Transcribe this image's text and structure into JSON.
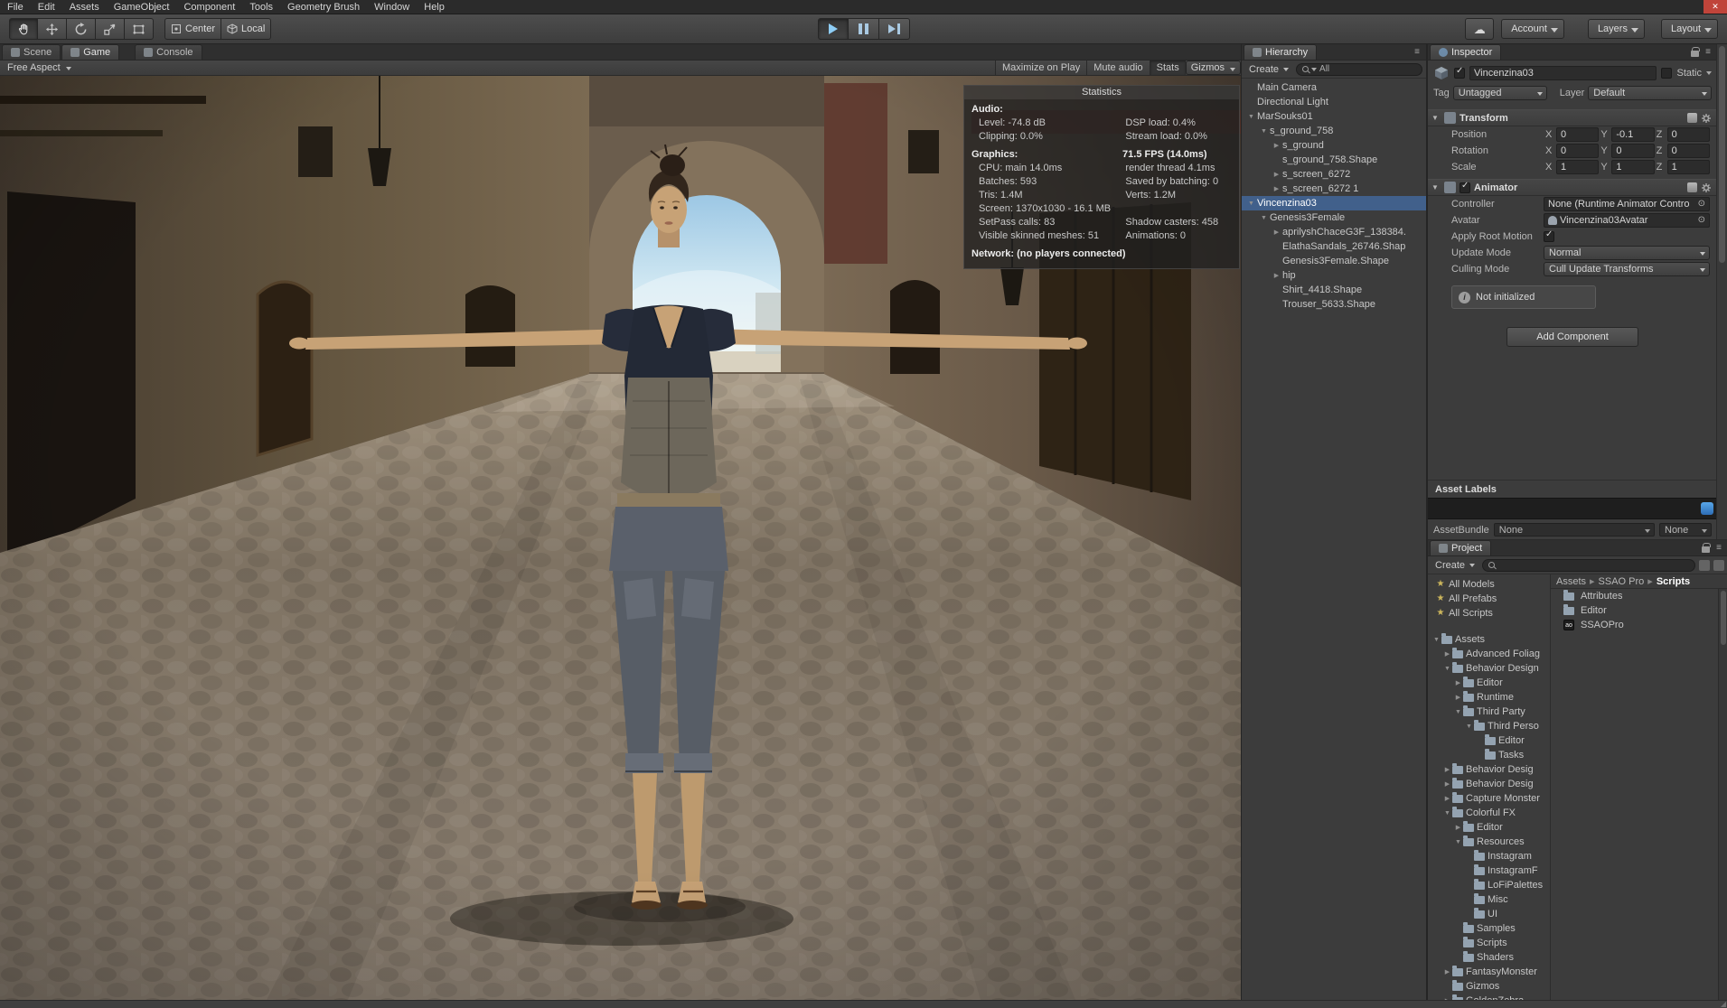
{
  "icons": {
    "close": "✕",
    "cloud": "☁",
    "star": "★",
    "info": "i",
    "picker": "⊙",
    "menu": "≡",
    "grip": "◢"
  },
  "menu": {
    "items": [
      "File",
      "Edit",
      "Assets",
      "GameObject",
      "Component",
      "Tools",
      "Geometry Brush",
      "Window",
      "Help"
    ]
  },
  "toolbar": {
    "center": "Center",
    "local": "Local",
    "account": "Account",
    "layers": "Layers",
    "layout": "Layout"
  },
  "left_tabs": [
    {
      "label": "Scene"
    },
    {
      "label": "Game",
      "active": true
    },
    {
      "label": "Console",
      "offset": true
    }
  ],
  "game_bar": {
    "aspect": "Free Aspect",
    "buttons": [
      {
        "label": "Maximize on Play"
      },
      {
        "label": "Mute audio"
      },
      {
        "label": "Stats",
        "active": true
      },
      {
        "label": "Gizmos",
        "dropdown": true
      }
    ]
  },
  "statistics": {
    "title": "Statistics",
    "rows": [
      {
        "left": "Audio:",
        "right": "",
        "bold": true
      },
      {
        "left": "Level: -74.8 dB",
        "right": "DSP load: 0.4%",
        "indent": true
      },
      {
        "left": "Clipping: 0.0%",
        "right": "Stream load: 0.0%",
        "indent": true
      },
      {
        "left": "Graphics:",
        "right": "71.5 FPS (14.0ms)",
        "bold": true,
        "gap": true
      },
      {
        "left": "CPU: main 14.0ms",
        "right": "render thread 4.1ms",
        "indent": true
      },
      {
        "left": "Batches: 593",
        "right": "Saved by batching: 0",
        "indent": true
      },
      {
        "left": "Tris: 1.4M",
        "right": "Verts: 1.2M",
        "indent": true
      },
      {
        "left": "Screen: 1370x1030 - 16.1 MB",
        "right": "",
        "indent": true
      },
      {
        "left": "SetPass calls: 83",
        "right": "Shadow casters: 458",
        "indent": true
      },
      {
        "left": "Visible skinned meshes: 51",
        "right": "Animations: 0",
        "indent": true
      },
      {
        "left": "Network: (no players connected)",
        "right": "",
        "bold": true,
        "gap": true
      }
    ]
  },
  "hierarchy": {
    "tab": "Hierarchy",
    "create": "Create",
    "search_text": "All",
    "items": [
      {
        "label": "Main Camera",
        "depth": 0
      },
      {
        "label": "Directional Light",
        "depth": 0
      },
      {
        "label": "MarSouks01",
        "depth": 0,
        "arrow": "down"
      },
      {
        "label": "s_ground_758",
        "depth": 1,
        "arrow": "down"
      },
      {
        "label": "s_ground",
        "depth": 2,
        "arrow": "right"
      },
      {
        "label": "s_ground_758.Shape",
        "depth": 2
      },
      {
        "label": "s_screen_6272",
        "depth": 2,
        "arrow": "right"
      },
      {
        "label": "s_screen_6272 1",
        "depth": 2,
        "arrow": "right"
      },
      {
        "label": "Vincenzina03",
        "depth": 0,
        "arrow": "down",
        "selected": true
      },
      {
        "label": "Genesis3Female",
        "depth": 1,
        "arrow": "down"
      },
      {
        "label": "aprilyshChaceG3F_138384.",
        "depth": 2,
        "arrow": "right"
      },
      {
        "label": "ElathaSandals_26746.Shap",
        "depth": 2
      },
      {
        "label": "Genesis3Female.Shape",
        "depth": 2
      },
      {
        "label": "hip",
        "depth": 2,
        "arrow": "right"
      },
      {
        "label": "Shirt_4418.Shape",
        "depth": 2
      },
      {
        "label": "Trouser_5633.Shape",
        "depth": 2
      }
    ]
  },
  "inspector": {
    "tab": "Inspector",
    "name": "Vincenzina03",
    "static_label": "Static",
    "tag_label": "Tag",
    "tag_value": "Untagged",
    "layer_label": "Layer",
    "layer_value": "Default",
    "transform": {
      "title": "Transform",
      "axis": [
        "X",
        "Y",
        "Z"
      ],
      "rows": [
        {
          "label": "Position",
          "x": "0",
          "y": "-0.1",
          "z": "0"
        },
        {
          "label": "Rotation",
          "x": "0",
          "y": "0",
          "z": "0"
        },
        {
          "label": "Scale",
          "x": "1",
          "y": "1",
          "z": "1"
        }
      ]
    },
    "animator": {
      "title": "Animator",
      "controller_label": "Controller",
      "controller_value": "None (Runtime Animator Contro",
      "avatar_label": "Avatar",
      "avatar_value": "Vincenzina03Avatar",
      "apply_root_motion_label": "Apply Root Motion",
      "update_mode_label": "Update Mode",
      "update_mode_value": "Normal",
      "culling_mode_label": "Culling Mode",
      "culling_mode_value": "Cull Update Transforms",
      "warning": "Not initialized"
    },
    "add_component": "Add Component"
  },
  "asset_labels": {
    "title": "Asset Labels",
    "assetbundle_label": "AssetBundle",
    "bundle_value": "None",
    "variant_value": "None"
  },
  "project": {
    "tab": "Project",
    "create": "Create",
    "breadcrumb": [
      {
        "label": "Assets"
      },
      {
        "label": "SSAO Pro"
      },
      {
        "label": "Scripts",
        "current": true
      }
    ],
    "favorites": [
      {
        "label": "All Models"
      },
      {
        "label": "All Prefabs"
      },
      {
        "label": "All Scripts"
      }
    ],
    "tree": [
      {
        "label": "Assets",
        "depth": 0,
        "arrow": "down"
      },
      {
        "label": "Advanced Foliag",
        "depth": 1,
        "arrow": "right"
      },
      {
        "label": "Behavior Design",
        "depth": 1,
        "arrow": "down"
      },
      {
        "label": "Editor",
        "depth": 2,
        "arrow": "right"
      },
      {
        "label": "Runtime",
        "depth": 2,
        "arrow": "right"
      },
      {
        "label": "Third Party",
        "depth": 2,
        "arrow": "down"
      },
      {
        "label": "Third Perso",
        "depth": 3,
        "arrow": "down"
      },
      {
        "label": "Editor",
        "depth": 4
      },
      {
        "label": "Tasks",
        "depth": 4
      },
      {
        "label": "Behavior Desig",
        "depth": 1,
        "arrow": "right"
      },
      {
        "label": "Behavior Desig",
        "depth": 1,
        "arrow": "right"
      },
      {
        "label": "Capture Monster",
        "depth": 1,
        "arrow": "right"
      },
      {
        "label": "Colorful FX",
        "depth": 1,
        "arrow": "down"
      },
      {
        "label": "Editor",
        "depth": 2,
        "arrow": "right"
      },
      {
        "label": "Resources",
        "depth": 2,
        "arrow": "down"
      },
      {
        "label": "Instagram",
        "depth": 3
      },
      {
        "label": "InstagramF",
        "depth": 3
      },
      {
        "label": "LoFiPalettes",
        "depth": 3
      },
      {
        "label": "Misc",
        "depth": 3
      },
      {
        "label": "UI",
        "depth": 3
      },
      {
        "label": "Samples",
        "depth": 2
      },
      {
        "label": "Scripts",
        "depth": 2
      },
      {
        "label": "Shaders",
        "depth": 2
      },
      {
        "label": "FantasyMonster",
        "depth": 1,
        "arrow": "right"
      },
      {
        "label": "Gizmos",
        "depth": 1
      },
      {
        "label": "GoldenZebra",
        "depth": 1,
        "arrow": "right"
      }
    ],
    "files": [
      {
        "label": "Attributes",
        "icon": "folder"
      },
      {
        "label": "Editor",
        "icon": "folder"
      },
      {
        "label": "SSAOPro",
        "icon": "ao",
        "badge": "ao"
      }
    ]
  }
}
